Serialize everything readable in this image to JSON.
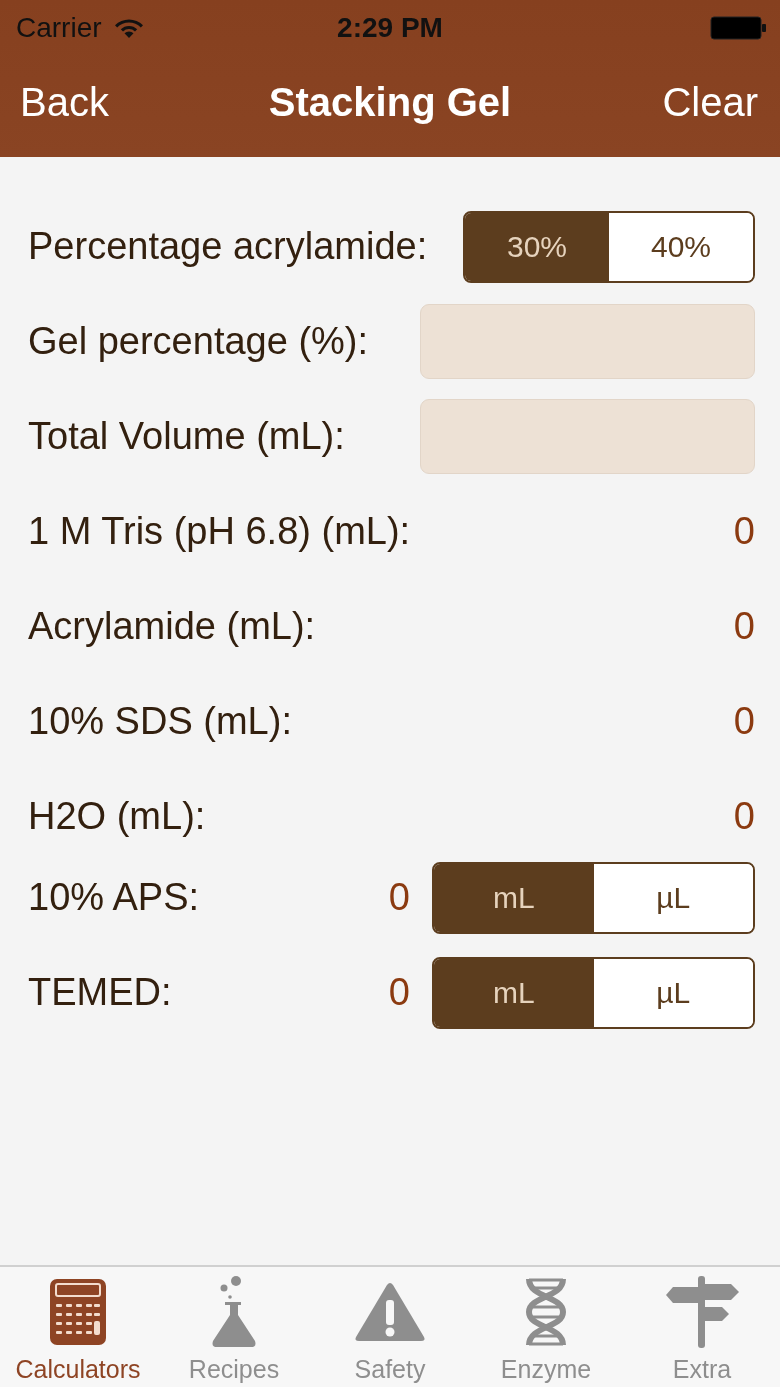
{
  "status_bar": {
    "carrier": "Carrier",
    "time": "2:29 PM"
  },
  "nav_bar": {
    "back": "Back",
    "title": "Stacking Gel",
    "action": "Clear"
  },
  "rows": [
    {
      "kind": "segmented",
      "label": "Percentage acrylamide:",
      "options": [
        {
          "label": "30%",
          "selected": true
        },
        {
          "label": "40%",
          "selected": false
        }
      ]
    },
    {
      "kind": "input",
      "label": "Gel percentage (%):"
    },
    {
      "kind": "input",
      "label": "Total Volume (mL):"
    },
    {
      "kind": "result",
      "label": "1 M Tris (pH 6.8) (mL):",
      "value": "0"
    },
    {
      "kind": "result",
      "label": "Acrylamide (mL):",
      "value": "0"
    },
    {
      "kind": "result",
      "label": "10% SDS (mL):",
      "value": "0"
    },
    {
      "kind": "result",
      "label": "H2O (mL):",
      "value": "0"
    },
    {
      "kind": "result_unit",
      "label": "10% APS:",
      "value": "0",
      "options": [
        {
          "label": "mL",
          "selected": true
        },
        {
          "label": "µL",
          "selected": false
        }
      ]
    },
    {
      "kind": "result_unit",
      "label": "TEMED:",
      "value": "0",
      "options": [
        {
          "label": "mL",
          "selected": true
        },
        {
          "label": "µL",
          "selected": false
        }
      ]
    }
  ],
  "tab_bar": {
    "items": [
      {
        "label": "Calculators",
        "selected": true
      },
      {
        "label": "Recipes",
        "selected": false
      },
      {
        "label": "Safety",
        "selected": false
      },
      {
        "label": "Enzyme",
        "selected": false
      },
      {
        "label": "Extra",
        "selected": false
      }
    ]
  }
}
